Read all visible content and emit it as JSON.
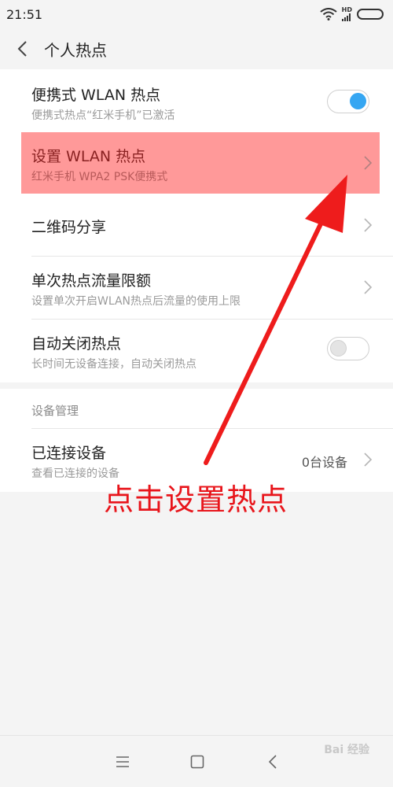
{
  "status_bar": {
    "time": "21:51",
    "network_label": "HD"
  },
  "header": {
    "title": "个人热点"
  },
  "rows": {
    "portable": {
      "title": "便携式 WLAN 热点",
      "subtitle": "便携式热点“红米手机”已激活",
      "enabled": true
    },
    "setup": {
      "title": "设置 WLAN 热点",
      "subtitle": "红米手机 WPA2 PSK便携式"
    },
    "qr": {
      "title": "二维码分享"
    },
    "limit": {
      "title": "单次热点流量限额",
      "subtitle": "设置单次开启WLAN热点后流量的使用上限"
    },
    "auto_off": {
      "title": "自动关闭热点",
      "subtitle": "长时间无设备连接，自动关闭热点",
      "enabled": false
    }
  },
  "device_section": {
    "header": "设备管理",
    "connected": {
      "title": "已连接设备",
      "subtitle": "查看已连接的设备",
      "count": "0台设备"
    }
  },
  "annotation": {
    "text": "点击设置热点",
    "color": "#e8151b"
  },
  "colors": {
    "accent": "#35a6f2",
    "highlight": "#ff5a5a"
  },
  "watermark": {
    "text": "Bai 经验"
  }
}
